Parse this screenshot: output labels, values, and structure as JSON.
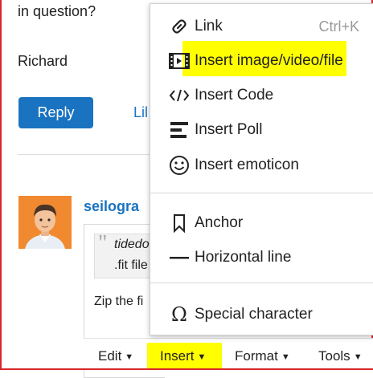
{
  "post": {
    "line1": "in question?",
    "signature": "Richard",
    "reply_label": "Reply",
    "like_label": "Lil"
  },
  "comment": {
    "username": "seilogra",
    "quote_user": "tidedo",
    "quote_file": ".fit file",
    "body": "Zip the fi"
  },
  "toolbar": {
    "edit_label": "Edit",
    "insert_label": "Insert",
    "format_label": "Format",
    "tools_label": "Tools"
  },
  "insert_menu": {
    "link_label": "Link",
    "link_shortcut": "Ctrl+K",
    "image_label": "Insert image/video/file",
    "code_label": "Insert Code",
    "poll_label": "Insert Poll",
    "emoticon_label": "Insert emoticon",
    "anchor_label": "Anchor",
    "hline_label": "Horizontal line",
    "special_label": "Special character"
  },
  "colors": {
    "accent": "#1a73c0",
    "highlight": "#ffff00",
    "frame": "#d7262b",
    "avatar_bg": "#f0892f"
  }
}
